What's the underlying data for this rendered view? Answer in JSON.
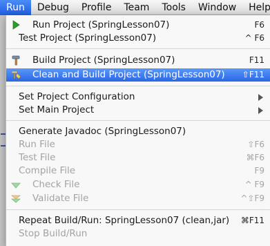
{
  "menubar": {
    "items": [
      "Run",
      "Debug",
      "Profile",
      "Team",
      "Tools",
      "Window",
      "Help"
    ]
  },
  "background": {
    "fragment": "1"
  },
  "run_menu": {
    "items": [
      {
        "label": "Run Project (SpringLesson07)",
        "shortcut": "F6",
        "icon": "run-play-icon"
      },
      {
        "label": "Test Project (SpringLesson07)",
        "shortcut": "^ F6"
      },
      {
        "label": "Build Project (SpringLesson07)",
        "shortcut": "F11",
        "icon": "build-hammer-icon"
      },
      {
        "label": "Clean and Build Project (SpringLesson07)",
        "shortcut": "⇧F11",
        "icon": "clean-build-icon",
        "selected": true
      },
      {
        "label": "Set Project Configuration",
        "submenu": true
      },
      {
        "label": "Set Main Project",
        "submenu": true
      },
      {
        "label": "Generate Javadoc (SpringLesson07)"
      },
      {
        "label": "Run File",
        "shortcut": "⇧F6",
        "disabled": true
      },
      {
        "label": "Test File",
        "shortcut": "⌘F6",
        "disabled": true
      },
      {
        "label": "Compile File",
        "shortcut": "F9",
        "disabled": true
      },
      {
        "label": "Check File",
        "shortcut": "^ F9",
        "disabled": true,
        "icon": "check-file-icon"
      },
      {
        "label": "Validate File",
        "shortcut": "^⇧F9",
        "disabled": true,
        "icon": "validate-file-icon"
      },
      {
        "label": "Repeat Build/Run: SpringLesson07 (clean,jar)",
        "shortcut": "⌘F11"
      },
      {
        "label": "Stop Build/Run",
        "disabled": true
      }
    ]
  },
  "colors": {
    "selection": "#2a66e6",
    "disabled_text": "#a3a3a3",
    "run_icon": "#2aa02a"
  }
}
